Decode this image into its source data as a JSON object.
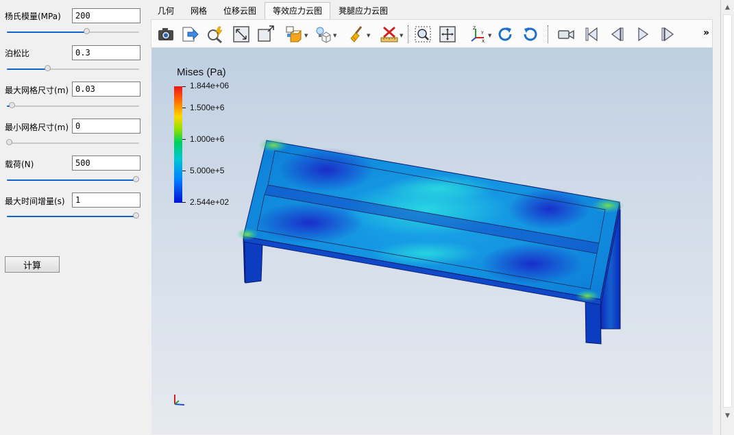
{
  "params": [
    {
      "label": "杨氏模量(MPa)",
      "value": "200",
      "slider_fraction": 0.61
    },
    {
      "label": "泊松比",
      "value": "0.3",
      "slider_fraction": 0.3
    },
    {
      "label": "最大网格尺寸(m)",
      "value": "0.03",
      "slider_fraction": 0.02
    },
    {
      "label": "最小网格尺寸(m)",
      "value": "0",
      "slider_fraction": 0.0
    },
    {
      "label": "载荷(N)",
      "value": "500",
      "slider_fraction": 1.0
    },
    {
      "label": "最大时间增量(s)",
      "value": "1",
      "slider_fraction": 1.0
    }
  ],
  "calc_button": "计算",
  "tabs": [
    {
      "label": "几何",
      "active": false
    },
    {
      "label": "网格",
      "active": false
    },
    {
      "label": "位移云图",
      "active": false
    },
    {
      "label": "等效应力云图",
      "active": true
    },
    {
      "label": "凳腿应力云图",
      "active": false
    }
  ],
  "toolbar": {
    "icons": [
      "camera-icon",
      "export-icon",
      "query-icon",
      "fit-view-icon",
      "zoom-box-icon",
      "view-cube-icon",
      "light-icon",
      "display-mode-icon",
      "clean-icon",
      "ruler-icon",
      "rubber-band-zoom-icon",
      "pan-icon",
      "axes-icon",
      "rotate-cw-icon",
      "rotate-ccw-icon",
      "video-camera-icon",
      "first-frame-icon",
      "prev-frame-icon",
      "play-icon",
      "next-frame-icon"
    ],
    "more": "»"
  },
  "legend": {
    "title": "Mises (Pa)",
    "labels": [
      "1.844e+06",
      "1.500e+6",
      "1.000e+6",
      "5.000e+5",
      "2.544e+02"
    ]
  },
  "colors": {
    "accent": "#0a64c8",
    "max_stress": "#e8161a",
    "min_stress": "#0010d8"
  }
}
